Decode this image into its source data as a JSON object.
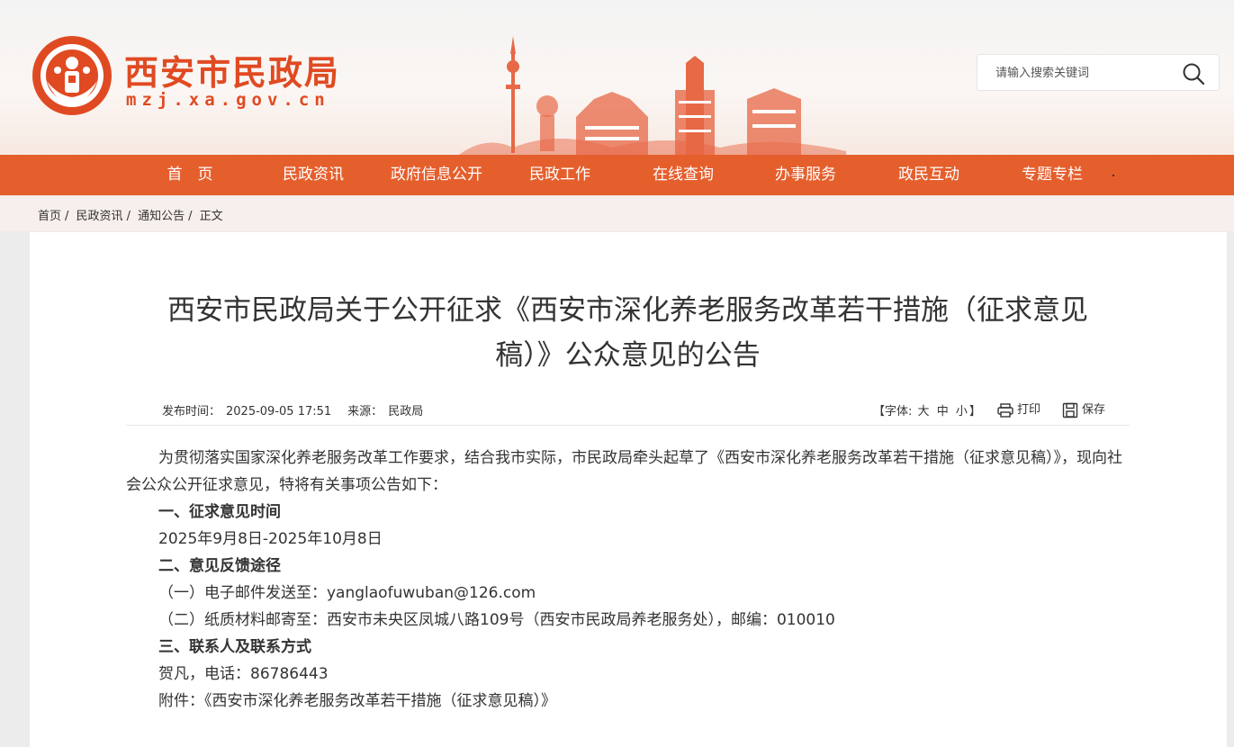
{
  "header": {
    "site_name": "西安市民政局",
    "site_domain": "mzj.xa.gov.cn",
    "search_placeholder": "请输入搜索关键词",
    "brand_color": "#e04a22"
  },
  "nav": {
    "items": [
      "首　页",
      "民政资讯",
      "政府信息公开",
      "民政工作",
      "在线查询",
      "办事服务",
      "政民互动",
      "专题专栏"
    ],
    "color": "#e55f2d"
  },
  "breadcrumb": {
    "items": [
      "首页",
      "民政资讯",
      "通知公告",
      "正文"
    ],
    "separator": "/"
  },
  "article": {
    "title_line1": "西安市民政局关于公开征求《西安市深化养老服务改革若干措施（征求意见",
    "title_line2": "稿）》公众意见的公告",
    "publish_label": "发布时间：",
    "publish_time": "2025-09-05 17:51",
    "source_label": "来源：",
    "source": "民政局",
    "font_label": "【字体:",
    "font_sizes": [
      "大",
      "中",
      "小"
    ],
    "font_close": "】",
    "print_label": "打印",
    "save_label": "保存",
    "intro": "为贯彻落实国家深化养老服务改革工作要求，结合我市实际，市民政局牵头起草了《西安市深化养老服务改革若干措施（征求意见稿）》，现向社会公众公开征求意见，特将有关事项公告如下：",
    "section1_heading": "一、征求意见时间",
    "section1_text": "2025年9月8日-2025年10月8日",
    "section2_heading": "二、意见反馈途径",
    "section2_item1_prefix": "（一）电子邮件发送至：",
    "section2_email": "yanglaofuwuban@126.com",
    "section2_item2": "（二）纸质材料邮寄至：西安市未央区凤城八路109号（西安市民政局养老服务处），邮编：010010",
    "section3_heading": "三、联系人及联系方式",
    "section3_text": "贺凡，电话：86786443",
    "attachment_label": "附件：",
    "attachment_name": "《西安市深化养老服务改革若干措施（征求意见稿）》"
  }
}
